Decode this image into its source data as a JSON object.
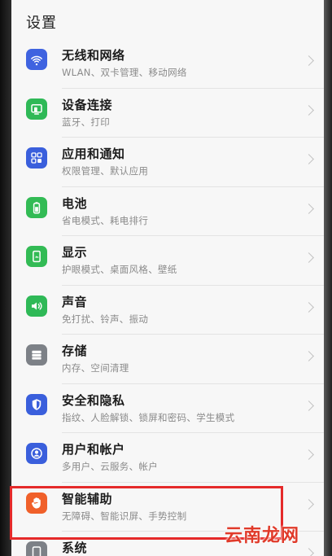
{
  "header": {
    "title": "设置"
  },
  "items": [
    {
      "title": "无线和网络",
      "subtitle": "WLAN、双卡管理、移动网络",
      "icon": "wifi-icon",
      "color": "#3f63e0"
    },
    {
      "title": "设备连接",
      "subtitle": "蓝牙、打印",
      "icon": "device-connect-icon",
      "color": "#2fb957"
    },
    {
      "title": "应用和通知",
      "subtitle": "权限管理、默认应用",
      "icon": "apps-icon",
      "color": "#3a5fdc"
    },
    {
      "title": "电池",
      "subtitle": "省电模式、耗电排行",
      "icon": "battery-icon",
      "color": "#33bb55"
    },
    {
      "title": "显示",
      "subtitle": "护眼模式、桌面风格、壁纸",
      "icon": "display-icon",
      "color": "#33bb55"
    },
    {
      "title": "声音",
      "subtitle": "免打扰、铃声、振动",
      "icon": "volume-icon",
      "color": "#2fb957"
    },
    {
      "title": "存储",
      "subtitle": "内存、空间清理",
      "icon": "storage-icon",
      "color": "#7d8187"
    },
    {
      "title": "安全和隐私",
      "subtitle": "指纹、人脸解锁、锁屏和密码、学生模式",
      "icon": "shield-icon",
      "color": "#3a5fdc"
    },
    {
      "title": "用户和帐户",
      "subtitle": "多用户、云服务、帐户",
      "icon": "user-icon",
      "color": "#3a5fdc"
    },
    {
      "title": "智能辅助",
      "subtitle": "无障碍、智能识屏、手势控制",
      "icon": "hand-icon",
      "color": "#f0602a"
    },
    {
      "title": "系统",
      "subtitle": "",
      "icon": "system-icon",
      "color": "#7d8187"
    }
  ],
  "watermark": "云南龙网"
}
